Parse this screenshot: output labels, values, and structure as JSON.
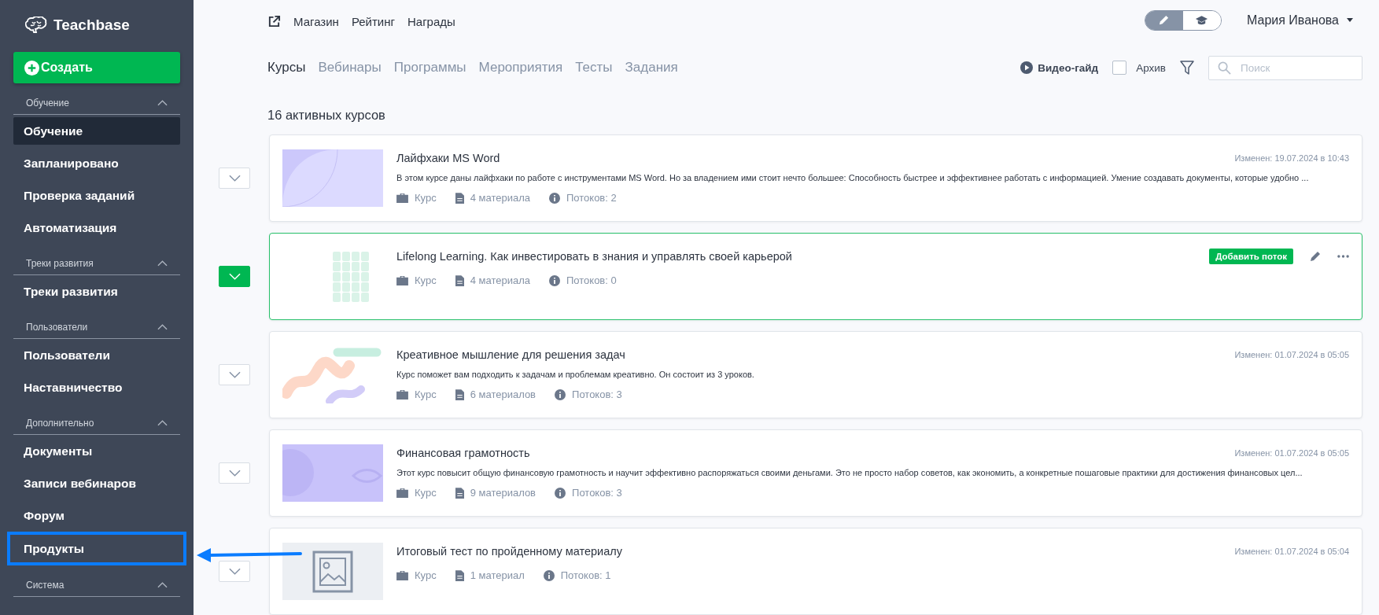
{
  "sidebar": {
    "logo": "Teachbase",
    "create_button": "Создать",
    "sections": [
      {
        "title": "Обучение",
        "expanded": true,
        "items": [
          {
            "label": "Обучение",
            "selected": true,
            "highlighted": false
          },
          {
            "label": "Запланировано",
            "selected": false,
            "highlighted": false
          },
          {
            "label": "Проверка заданий",
            "selected": false,
            "highlighted": false
          },
          {
            "label": "Автоматизация",
            "selected": false,
            "highlighted": false
          }
        ]
      },
      {
        "title": "Треки развития",
        "expanded": true,
        "items": [
          {
            "label": "Треки развития",
            "selected": false,
            "highlighted": false
          }
        ]
      },
      {
        "title": "Пользователи",
        "expanded": true,
        "items": [
          {
            "label": "Пользователи",
            "selected": false,
            "highlighted": false
          },
          {
            "label": "Наставничество",
            "selected": false,
            "highlighted": false
          }
        ]
      },
      {
        "title": "Дополнительно",
        "expanded": true,
        "items": [
          {
            "label": "Документы",
            "selected": false,
            "highlighted": false
          },
          {
            "label": "Записи вебинаров",
            "selected": false,
            "highlighted": false
          },
          {
            "label": "Форум",
            "selected": false,
            "highlighted": false
          },
          {
            "label": "Продукты",
            "selected": false,
            "highlighted": true
          }
        ]
      },
      {
        "title": "Система",
        "expanded": true
      }
    ]
  },
  "top_links": [
    "Магазин",
    "Рейтинг",
    "Награды"
  ],
  "mode_toggle": [
    {
      "kind": "edit",
      "selected": true
    },
    {
      "kind": "learn",
      "selected": false
    }
  ],
  "user": {
    "name": "Мария Иванова"
  },
  "tabs": [
    {
      "label": "Курсы",
      "selected": true
    },
    {
      "label": "Вебинары",
      "selected": false
    },
    {
      "label": "Программы",
      "selected": false
    },
    {
      "label": "Мероприятия",
      "selected": false
    },
    {
      "label": "Тесты",
      "selected": false
    },
    {
      "label": "Задания",
      "selected": false
    }
  ],
  "tools": {
    "video_guide": "Видео-гайд",
    "archive": {
      "label": "Архив",
      "checked": false
    },
    "search": {
      "placeholder": "Поиск"
    }
  },
  "count": "16 активных курсов",
  "courses": [
    {
      "kind": "leaf",
      "selected": false,
      "title": "Лайфхаки MS Word",
      "modified": "Изменен: 19.07.2024 в 10:43",
      "description": "В этом курсе даны лайфхаки по работе с инструментами MS Word. Но за владением ими стоит нечто большее: Способность быстрее и эффективнее работать с информацией. Умение создавать документы, которые удобно ...",
      "type": "Курс",
      "materials": "4 материала",
      "streams": "Потоков: 2"
    },
    {
      "kind": "grid",
      "selected": true,
      "title": "Lifelong Learning. Как инвестировать в знания и управлять своей карьерой",
      "add_stream": "Добавить поток",
      "type": "Курс",
      "materials": "4 материала",
      "streams": "Потоков: 0"
    },
    {
      "kind": "brush",
      "selected": false,
      "title": "Креативное мышление для решения задач",
      "modified": "Изменен: 01.07.2024 в 05:05",
      "description": "Курс поможет вам подходить к задачам и проблемам креативно. Он состоит из 3 уроков.",
      "type": "Курс",
      "materials": "6 материалов",
      "streams": "Потоков: 3"
    },
    {
      "kind": "eye",
      "selected": false,
      "title": "Финансовая грамотность",
      "modified": "Изменен: 01.07.2024 в 05:05",
      "description": "Этот курс повысит общую финансовую грамотность и научит эффективно распоряжаться своими деньгами. Это не просто набор советов, как экономить, а конкретные пошаговые практики для достижения финансовых цел...",
      "type": "Курс",
      "materials": "9 материалов",
      "streams": "Потоков: 3"
    },
    {
      "kind": "placeholder",
      "selected": false,
      "title": "Итоговый тест по пройденному материалу",
      "modified": "Изменен: 01.07.2024 в 05:04",
      "type": "Курс",
      "materials": "1 материал",
      "streams": "Потоков: 1"
    }
  ]
}
